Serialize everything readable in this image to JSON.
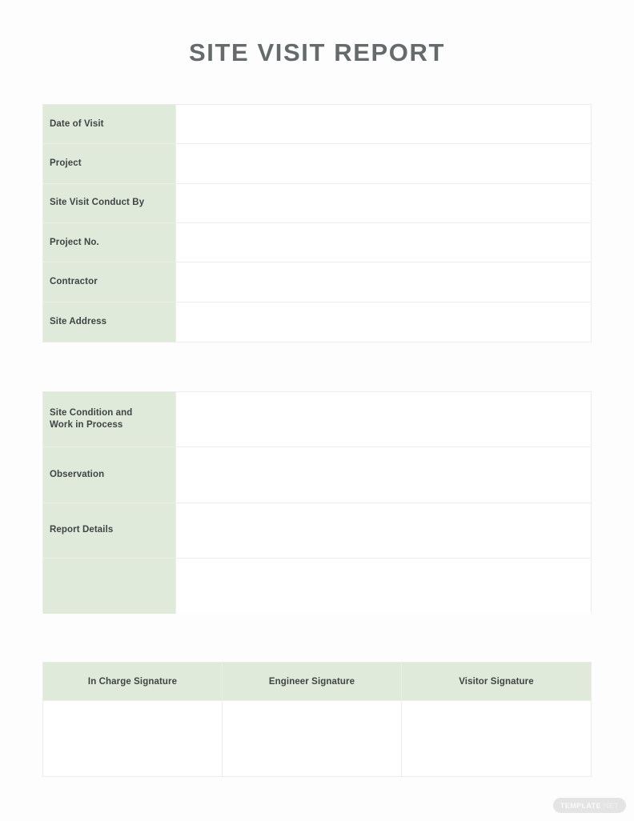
{
  "document": {
    "title": "SITE VISIT REPORT",
    "colors": {
      "label_green": "#dfeada",
      "border_gray": "#ececec",
      "title_gray": "#656b6b",
      "label_text": "#3f4545",
      "page_background": "#fdfdfd"
    }
  },
  "details_table": {
    "rows": [
      {
        "label": "Date of Visit",
        "value": ""
      },
      {
        "label": "Project",
        "value": ""
      },
      {
        "label": "Site Visit Conduct By",
        "value": ""
      },
      {
        "label": "Project No.",
        "value": ""
      },
      {
        "label": "Contractor",
        "value": ""
      },
      {
        "label": "Site Address",
        "value": ""
      }
    ]
  },
  "narrative_table": {
    "rows": [
      {
        "label_line1": "Site Condition and",
        "label_line2": "Work in Process",
        "value": ""
      },
      {
        "label_line1": "Observation",
        "label_line2": "",
        "value": ""
      },
      {
        "label_line1": "Report Details",
        "label_line2": "",
        "value": ""
      },
      {
        "label_line1": "",
        "label_line2": "",
        "value": ""
      }
    ]
  },
  "signature_table": {
    "headers": [
      "In Charge Signature",
      "Engineer Signature",
      "Visitor Signature"
    ],
    "cells": [
      "",
      "",
      ""
    ]
  },
  "watermark": {
    "brand": "TEMPLATE",
    "suffix": ".NET"
  }
}
